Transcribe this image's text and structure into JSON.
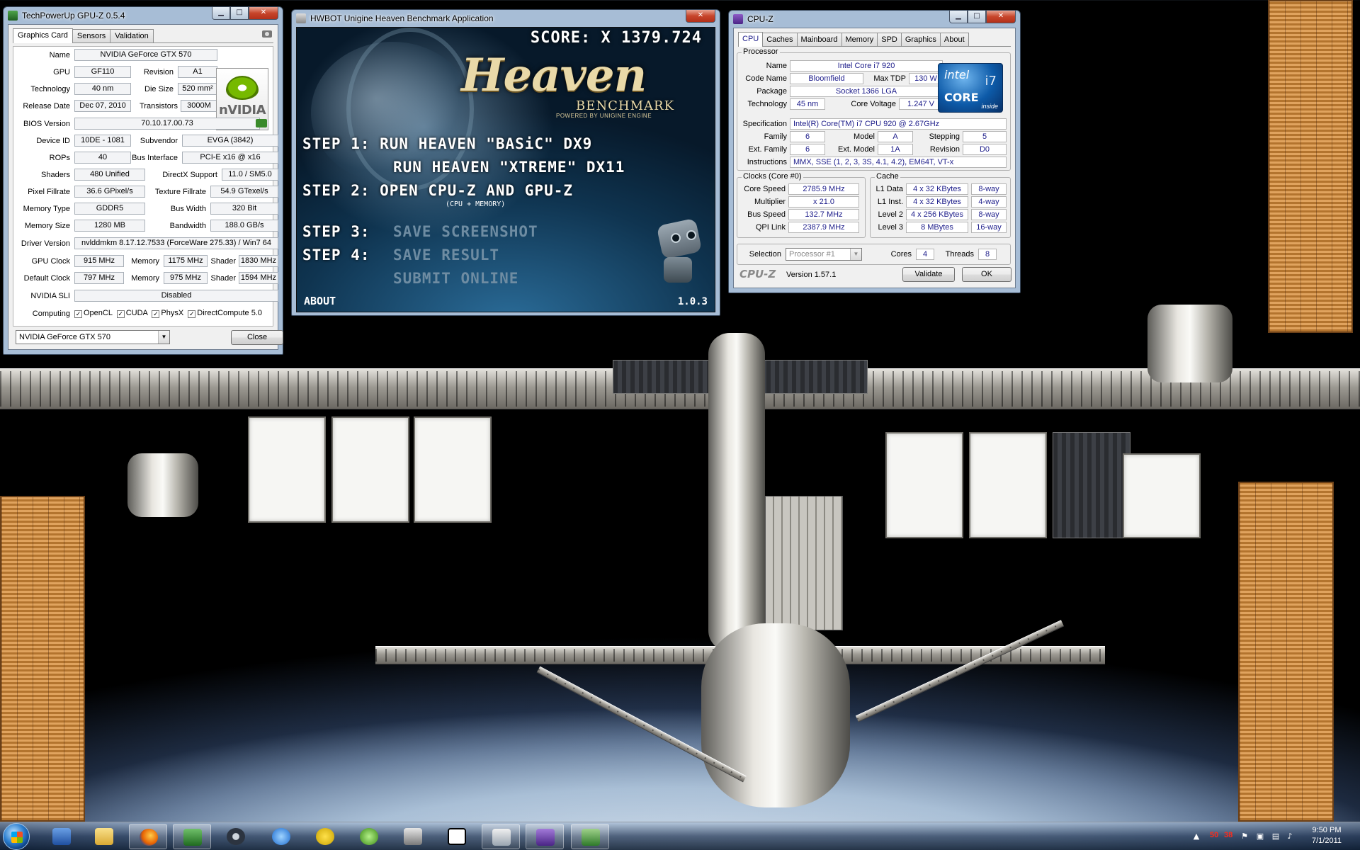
{
  "gpuz": {
    "title": "TechPowerUp GPU-Z 0.5.4",
    "tabs": [
      "Graphics Card",
      "Sensors",
      "Validation"
    ],
    "fields": {
      "name_label": "Name",
      "name": "NVIDIA GeForce GTX 570",
      "gpu_label": "GPU",
      "gpu": "GF110",
      "revision_label": "Revision",
      "revision": "A1",
      "technology_label": "Technology",
      "technology": "40 nm",
      "die_size_label": "Die Size",
      "die_size": "520 mm²",
      "release_date_label": "Release Date",
      "release_date": "Dec 07, 2010",
      "transistors_label": "Transistors",
      "transistors": "3000M",
      "bios_label": "BIOS Version",
      "bios": "70.10.17.00.73",
      "device_id_label": "Device ID",
      "device_id": "10DE - 1081",
      "subvendor_label": "Subvendor",
      "subvendor": "EVGA (3842)",
      "rops_label": "ROPs",
      "rops": "40",
      "bus_interface_label": "Bus Interface",
      "bus_interface": "PCI-E x16 @ x16",
      "shaders_label": "Shaders",
      "shaders": "480 Unified",
      "directx_label": "DirectX Support",
      "directx": "11.0 / SM5.0",
      "pixel_fillrate_label": "Pixel Fillrate",
      "pixel_fillrate": "36.6 GPixel/s",
      "texture_fillrate_label": "Texture Fillrate",
      "texture_fillrate": "54.9 GTexel/s",
      "memory_type_label": "Memory Type",
      "memory_type": "GDDR5",
      "bus_width_label": "Bus Width",
      "bus_width": "320 Bit",
      "memory_size_label": "Memory Size",
      "memory_size": "1280 MB",
      "bandwidth_label": "Bandwidth",
      "bandwidth": "188.0 GB/s",
      "driver_label": "Driver Version",
      "driver": "nvlddmkm 8.17.12.7533 (ForceWare 275.33) / Win7 64",
      "gpu_clock_label": "GPU Clock",
      "gpu_clock": "915 MHz",
      "memory_label": "Memory",
      "gpu_clock_memory": "1175 MHz",
      "shader_label": "Shader",
      "gpu_clock_shader": "1830 MHz",
      "default_clock_label": "Default Clock",
      "default_clock": "797 MHz",
      "default_memory": "975 MHz",
      "default_shader": "1594 MHz",
      "sli_label": "NVIDIA SLI",
      "sli": "Disabled",
      "computing_label": "Computing",
      "opencl": "OpenCL",
      "cuda": "CUDA",
      "physx": "PhysX",
      "directcompute": "DirectCompute 5.0"
    },
    "logo_text": "nVIDIA",
    "selected_card": "NVIDIA GeForce GTX 570",
    "close_label": "Close"
  },
  "heaven": {
    "title": "HWBOT Unigine Heaven Benchmark Application",
    "score": "SCORE: X 1379.724",
    "logo": "Heaven",
    "logo_sub": "BENCHMARK",
    "powered": "POWERED BY UNIGINE ENGINE",
    "step1": "STEP 1:  RUN HEAVEN \"BASiC\" DX9",
    "step1b": "RUN HEAVEN \"XTREME\" DX11",
    "step2": "STEP 2: OPEN CPU-Z  AND  GPU-Z",
    "step2_note": "(CPU + MEMORY)",
    "step3_prefix": "STEP 3:",
    "step3_action": "SAVE SCREENSHOT",
    "step4_prefix": "STEP 4:",
    "step4_action": "SAVE RESULT",
    "step4b": "SUBMIT ONLINE",
    "about": "ABOUT",
    "version": "1.0.3"
  },
  "cpuz": {
    "title": "CPU-Z",
    "tabs": [
      "CPU",
      "Caches",
      "Mainboard",
      "Memory",
      "SPD",
      "Graphics",
      "About"
    ],
    "processor_group": "Processor",
    "name_label": "Name",
    "name": "Intel Core i7 920",
    "code_name_label": "Code Name",
    "code_name": "Bloomfield",
    "max_tdp_label": "Max TDP",
    "max_tdp": "130 W",
    "package_label": "Package",
    "package": "Socket 1366 LGA",
    "technology_label": "Technology",
    "technology": "45 nm",
    "core_voltage_label": "Core Voltage",
    "core_voltage": "1.247 V",
    "specification_label": "Specification",
    "specification": "Intel(R) Core(TM) i7 CPU       920  @ 2.67GHz",
    "family_label": "Family",
    "family": "6",
    "model_label": "Model",
    "model": "A",
    "stepping_label": "Stepping",
    "stepping": "5",
    "ext_family_label": "Ext. Family",
    "ext_family": "6",
    "ext_model_label": "Ext. Model",
    "ext_model": "1A",
    "revision_label": "Revision",
    "revision": "D0",
    "instructions_label": "Instructions",
    "instructions": "MMX, SSE (1, 2, 3, 3S, 4.1, 4.2), EM64T, VT-x",
    "logo_intel": "intel",
    "logo_i7": "i7",
    "logo_core": "CORE",
    "logo_inside": "inside",
    "clocks_group": "Clocks (Core #0)",
    "core_speed_label": "Core Speed",
    "core_speed": "2785.9 MHz",
    "multiplier_label": "Multiplier",
    "multiplier": "x 21.0",
    "bus_speed_label": "Bus Speed",
    "bus_speed": "132.7 MHz",
    "qpi_label": "QPI Link",
    "qpi": "2387.9 MHz",
    "cache_group": "Cache",
    "l1d_label": "L1 Data",
    "l1d": "4 x 32 KBytes",
    "l1d_way": "8-way",
    "l1i_label": "L1 Inst.",
    "l1i": "4 x 32 KBytes",
    "l1i_way": "4-way",
    "l2_label": "Level 2",
    "l2": "4 x 256 KBytes",
    "l2_way": "8-way",
    "l3_label": "Level 3",
    "l3": "8 MBytes",
    "l3_way": "16-way",
    "selection_label": "Selection",
    "selection": "Processor #1",
    "cores_label": "Cores",
    "cores": "4",
    "threads_label": "Threads",
    "threads": "8",
    "brand": "CPU-Z",
    "version": "Version 1.57.1",
    "validate_label": "Validate",
    "ok_label": "OK"
  },
  "taskbar": {
    "apps": [
      "word-icon",
      "explorer-icon",
      "firefox-icon",
      "gpuz-icon",
      "steam-icon",
      "itunes-icon",
      "norton-icon",
      "xbox-icon",
      "game-icon",
      "7zip-icon",
      "app-icon",
      "cpuz-icon",
      "heaven-icon"
    ],
    "temp1": "50",
    "temp2": "38",
    "time": "9:50 PM",
    "date": "7/1/2011"
  },
  "colors": {
    "window_frame": "#a7bdd6",
    "value_text": "#1c1c8a",
    "heaven_title_gold": "#e9d9a8",
    "nvidia_green": "#76b900"
  }
}
